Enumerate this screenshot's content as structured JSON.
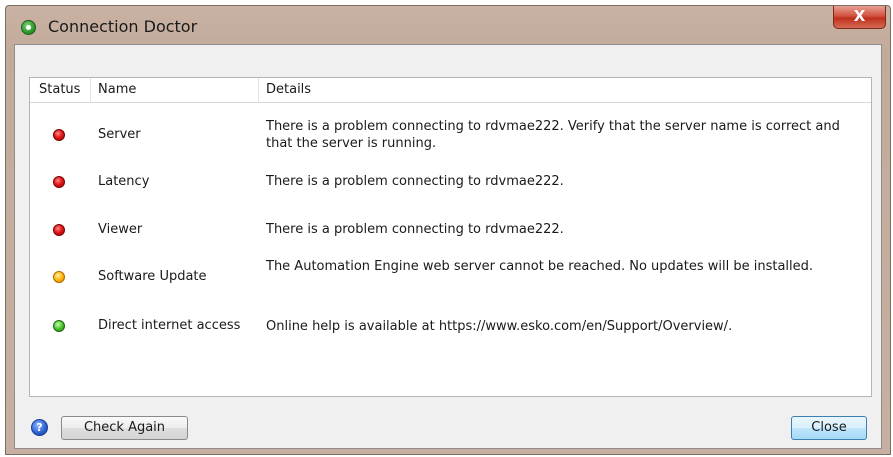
{
  "window": {
    "title": "Connection Doctor",
    "close_glyph": "X"
  },
  "table": {
    "columns": [
      "Status",
      "Name",
      "Details"
    ],
    "rows": [
      {
        "status": "red",
        "name": "Server",
        "details": "There is a problem connecting to rdvmae222. Verify that the server name is correct and that the server is running."
      },
      {
        "status": "red",
        "name": "Latency",
        "details": "There is a problem connecting to rdvmae222."
      },
      {
        "status": "red",
        "name": "Viewer",
        "details": "There is a problem connecting to rdvmae222."
      },
      {
        "status": "yellow",
        "name": "Software Update",
        "details": "The Automation Engine web server cannot be reached. No updates will be installed."
      },
      {
        "status": "green",
        "name": "Direct internet access",
        "details": "Online help is available at https://www.esko.com/en/Support/Overview/."
      }
    ]
  },
  "footer": {
    "help_glyph": "?",
    "check_again_label": "Check Again",
    "close_label": "Close"
  },
  "colors": {
    "status_red": "#e01818",
    "status_yellow": "#ffb60f",
    "status_green": "#4cc22e",
    "title_bar": "#c3ab9c"
  },
  "icons": {
    "app": "app-status-icon",
    "help": "help-icon",
    "close": "close-icon"
  }
}
